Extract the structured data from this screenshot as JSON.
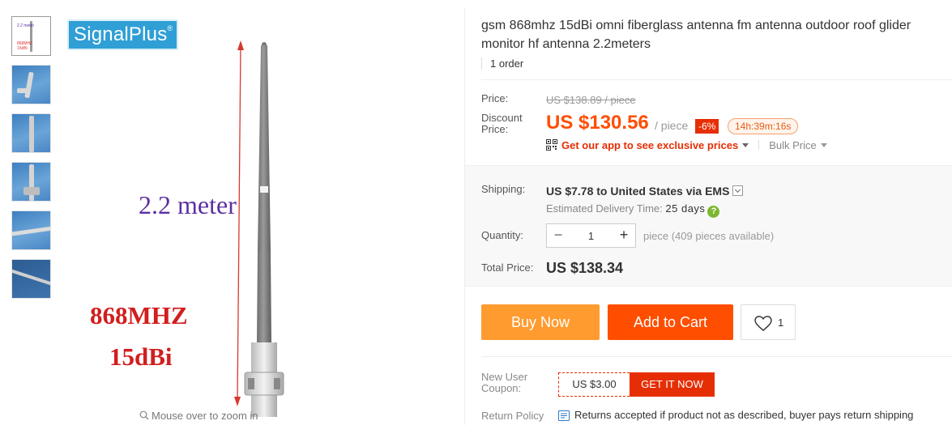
{
  "gallery": {
    "thumbnails": [
      {
        "name": "thumbnail-1",
        "caption_top": "2.2 meter",
        "caption_mid": "868MHZ",
        "caption_bot": "15dBi"
      },
      {
        "name": "thumbnail-2"
      },
      {
        "name": "thumbnail-3"
      },
      {
        "name": "thumbnail-4"
      },
      {
        "name": "thumbnail-5"
      },
      {
        "name": "thumbnail-6"
      }
    ],
    "main_image": {
      "brand": "SignalPlus",
      "brand_mark": "®",
      "height_label": "2.2 meter",
      "freq_label": "868MHZ",
      "gain_label": "15dBi"
    },
    "zoom_hint": "Mouse over to zoom in",
    "zoom_icon": "magnifier-icon"
  },
  "product": {
    "title": "gsm 868mhz 15dBi omni fiberglass antenna fm antenna outdoor roof glider monitor hf antenna 2.2meters",
    "orders": "1 order"
  },
  "pricing": {
    "price_label": "Price:",
    "original_price": "US $138.89 / piece",
    "discount_label": "Discount Price:",
    "discount_price": "US $130.56",
    "unit": "/ piece",
    "discount_badge": "-6%",
    "countdown": "14h:39m:16s",
    "app_link": "Get our app to see exclusive prices",
    "bulk_price": "Bulk Price",
    "colors": {
      "accent": "#ff4e00",
      "badge": "#e62e04"
    }
  },
  "shipping": {
    "label": "Shipping:",
    "cost": "US $7.78",
    "to": "to United States via EMS",
    "delivery_label": "Estimated Delivery Time:",
    "delivery_days": "25 days"
  },
  "quantity": {
    "label": "Quantity:",
    "value": "1",
    "available": "piece (409 pieces available)"
  },
  "total": {
    "label": "Total Price:",
    "value": "US $138.34"
  },
  "actions": {
    "buy_now": "Buy Now",
    "add_to_cart": "Add to Cart",
    "wishlist_count": "1",
    "colors": {
      "buy": "#ff9b2f",
      "cart": "#ff4e00"
    }
  },
  "coupon": {
    "label": "New User Coupon:",
    "value": "US $3.00",
    "cta": "GET IT NOW"
  },
  "returns": {
    "label": "Return Policy",
    "text": "Returns accepted if product not as described, buyer pays return shipping"
  }
}
